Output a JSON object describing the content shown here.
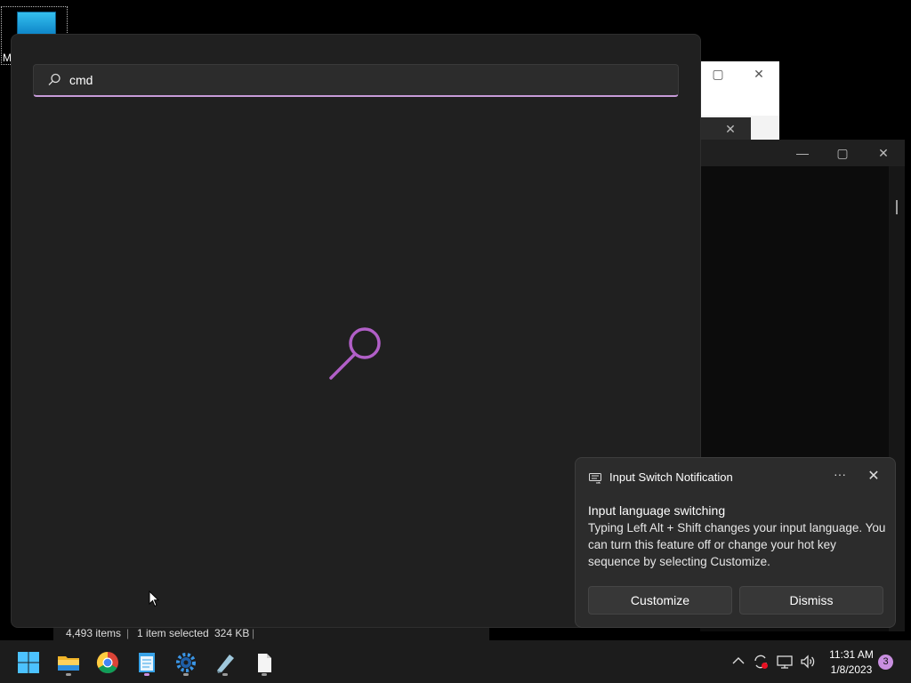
{
  "desktop": {
    "icon_label": "M"
  },
  "explorer_status": {
    "items_count": "4,493 items",
    "selection": "1 item selected",
    "size": "324 KB"
  },
  "search": {
    "query": "cmd"
  },
  "notification": {
    "app_name": "Input Switch Notification",
    "more_label": "···",
    "close_label": "✕",
    "heading": "Input language switching",
    "body": "Typing Left Alt + Shift changes your input language. You can turn this feature off or change your hot key sequence by selecting Customize.",
    "customize_label": "Customize",
    "dismiss_label": "Dismiss"
  },
  "taskbar": {
    "apps": [
      "start-icon",
      "file-explorer-icon",
      "chrome-icon",
      "notepad-icon",
      "settings-gear-icon",
      "paint-icon",
      "document-icon"
    ],
    "time": "11:31 AM",
    "date": "1/8/2023",
    "notification_count": "3"
  },
  "colors": {
    "accent": "#c79bd9",
    "panel_bg": "#202020",
    "taskbar_bg": "#1c1c1c"
  }
}
